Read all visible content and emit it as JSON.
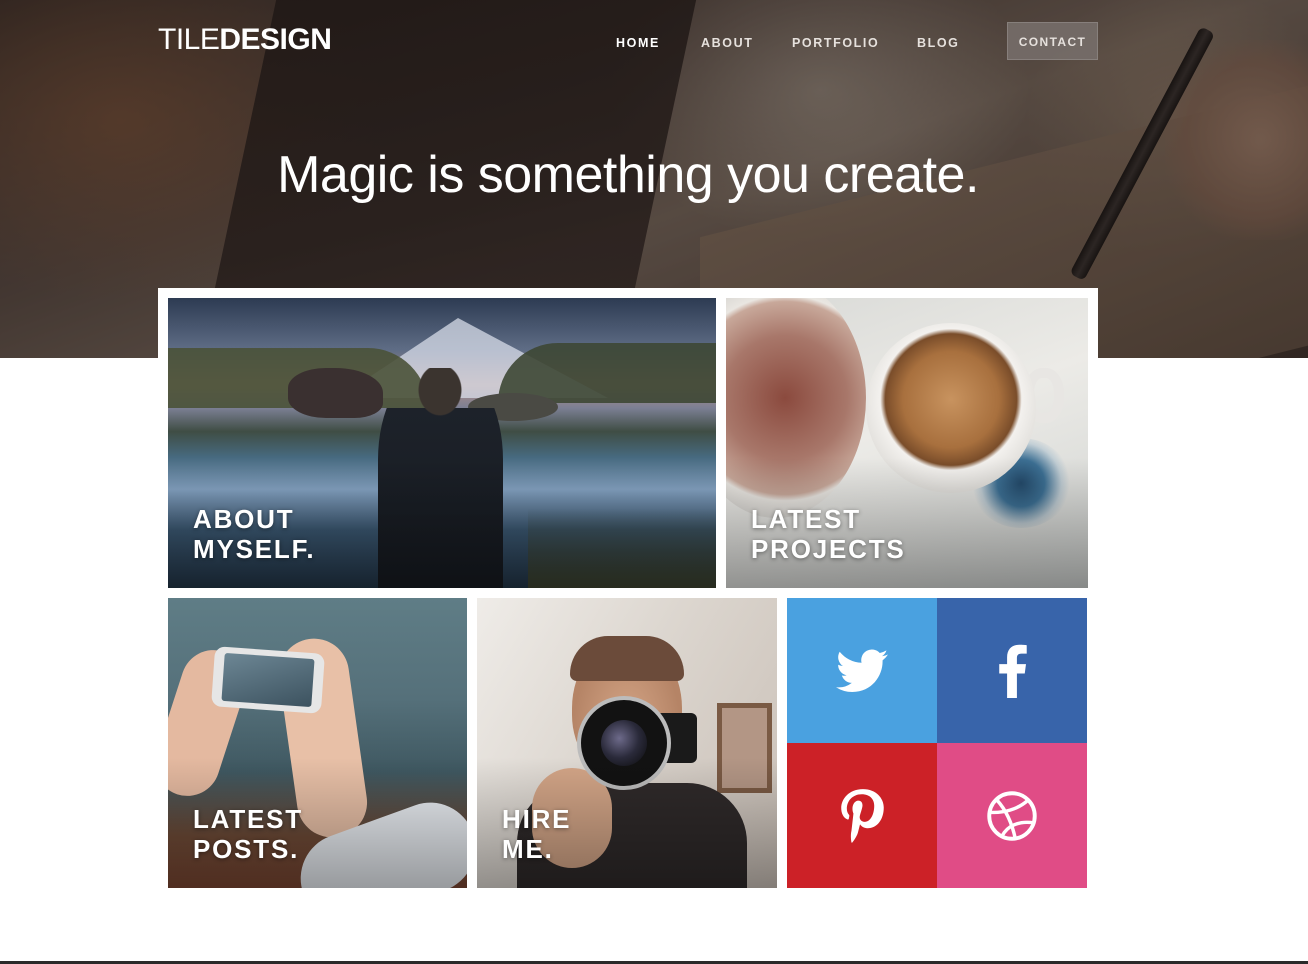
{
  "header": {
    "logo_light": "TILE",
    "logo_bold": "DESIGN",
    "nav": [
      {
        "label": "HOME"
      },
      {
        "label": "ABOUT"
      },
      {
        "label": "PORTFOLIO"
      },
      {
        "label": "BLOG"
      }
    ],
    "contact_label": "CONTACT"
  },
  "hero": {
    "tagline": "Magic is something you create."
  },
  "tiles": {
    "about": {
      "line1": "ABOUT",
      "line2": "MYSELF."
    },
    "projects": {
      "line1": "LATEST",
      "line2": "PROJECTS"
    },
    "posts": {
      "line1": "LATEST",
      "line2": "POSTS."
    },
    "hire": {
      "line1": "HIRE",
      "line2": "ME."
    }
  },
  "social": [
    {
      "name": "twitter",
      "icon": "twitter-icon",
      "color": "#4aa1e0"
    },
    {
      "name": "facebook",
      "icon": "facebook-icon",
      "color": "#3864aa"
    },
    {
      "name": "pinterest",
      "icon": "pinterest-icon",
      "color": "#cc2127"
    },
    {
      "name": "dribbble",
      "icon": "dribbble-icon",
      "color": "#e04c86"
    }
  ]
}
